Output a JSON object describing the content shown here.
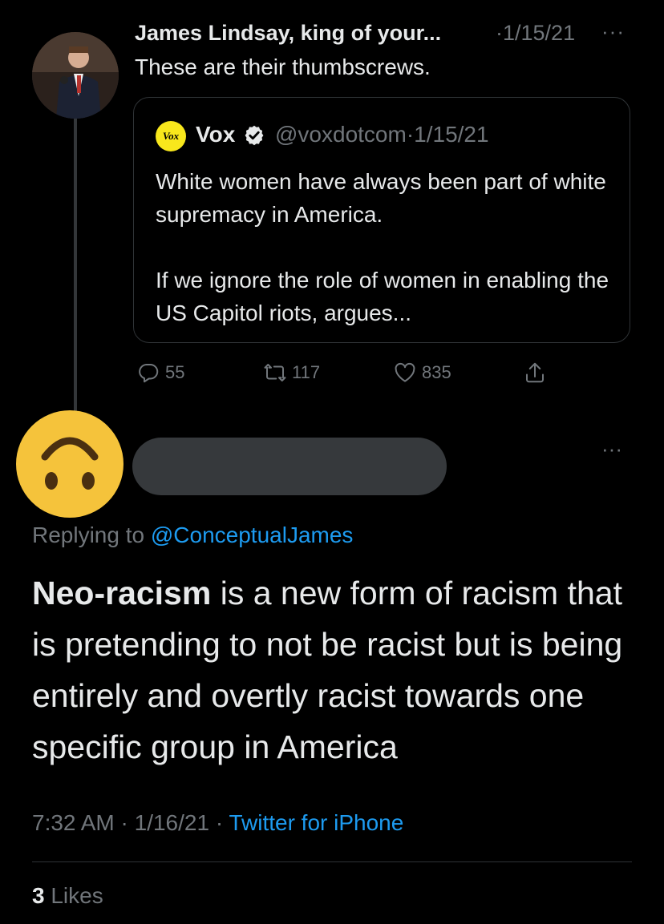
{
  "tweet": {
    "author_name": "James Lindsay, king of your...",
    "separator": "·",
    "date": "1/15/21",
    "more_label": "···",
    "text": "These are their thumbscrews."
  },
  "quote": {
    "logo_text": "Vox",
    "name": "Vox",
    "handle": "@voxdotcom",
    "date": "1/15/21",
    "paragraph1": "White women have always been part of white supremacy in America.",
    "paragraph2": "If we ignore the role of women in enabling the US Capitol riots, argues..."
  },
  "actions": {
    "replies": "55",
    "retweets": "117",
    "likes": "835"
  },
  "reply": {
    "more_label": "···",
    "replying_prefix": "Replying to",
    "replying_handle": "@ConceptualJames",
    "bold_term": "Neo-racism",
    "body": " is a new form of racism that is pretending to not be racist but is being entirely and overtly racist towards one specific group in America",
    "time": "7:32 AM",
    "date": "1/16/21",
    "source": "Twitter for iPhone",
    "likes_count": "3",
    "likes_label": "Likes"
  },
  "colors": {
    "background": "#000000",
    "text": "#e7e9ea",
    "muted": "#71767b",
    "link": "#1d9bf0",
    "verified": "#e7e9ea",
    "vox_logo": "#f8e71c",
    "emoji": "#f5c33b"
  },
  "icons": [
    "verified-badge-icon",
    "reply-icon",
    "retweet-icon",
    "like-icon",
    "share-icon",
    "upside-down-face-emoji"
  ]
}
